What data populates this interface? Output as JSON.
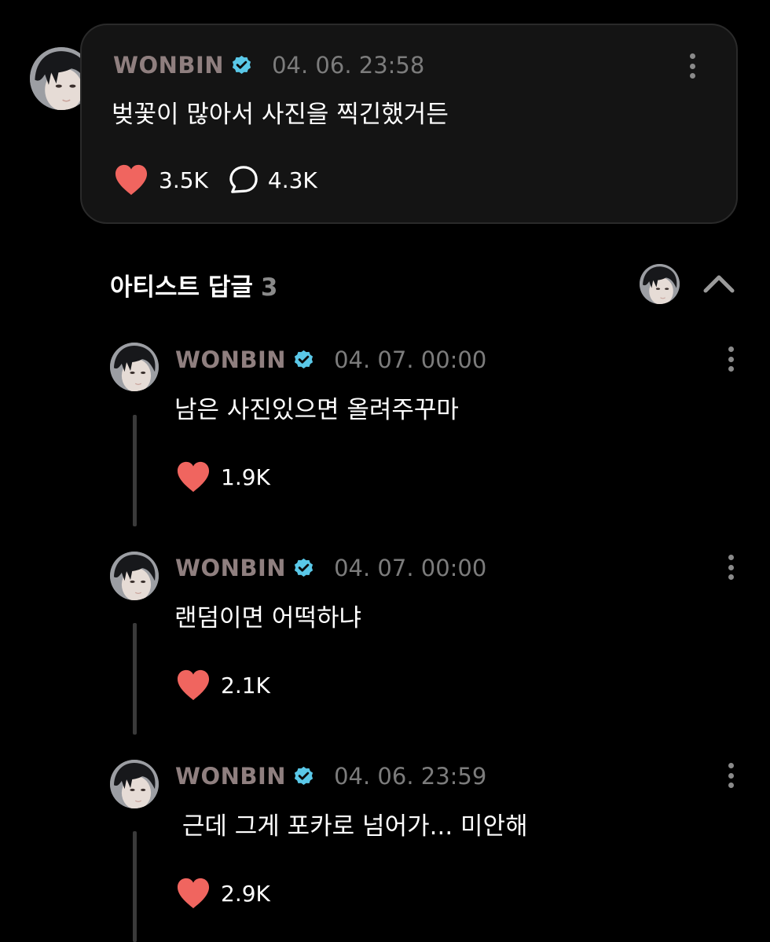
{
  "post": {
    "author": "WONBIN",
    "timestamp": "04. 06. 23:58",
    "text": "벚꽃이 많아서 사진을 찍긴했거든",
    "likes": "3.5K",
    "comments": "4.3K"
  },
  "replies_section": {
    "title": "아티스트 답글",
    "count": "3"
  },
  "replies": [
    {
      "author": "WONBIN",
      "timestamp": "04. 07. 00:00",
      "text": "남은 사진있으면 올려주꾸마",
      "likes": "1.9K"
    },
    {
      "author": "WONBIN",
      "timestamp": "04. 07. 00:00",
      "text": "랜덤이면 어떡하냐",
      "likes": "2.1K"
    },
    {
      "author": "WONBIN",
      "timestamp": "04. 06. 23:59",
      "text": " 근데 그게 포카로 넘어가... 미안해",
      "likes": "2.9K"
    }
  ],
  "icons": {
    "verified": "verified-badge-icon",
    "like": "heart-icon",
    "comment": "comment-bubble-icon",
    "more": "more-vertical-icon",
    "collapse": "chevron-up-icon"
  },
  "colors": {
    "background": "#000000",
    "card": "#141414",
    "author": "#8f7f7f",
    "verified": "#5ac8e8",
    "heart": "#f0655f",
    "muted": "#7c7c7c"
  }
}
